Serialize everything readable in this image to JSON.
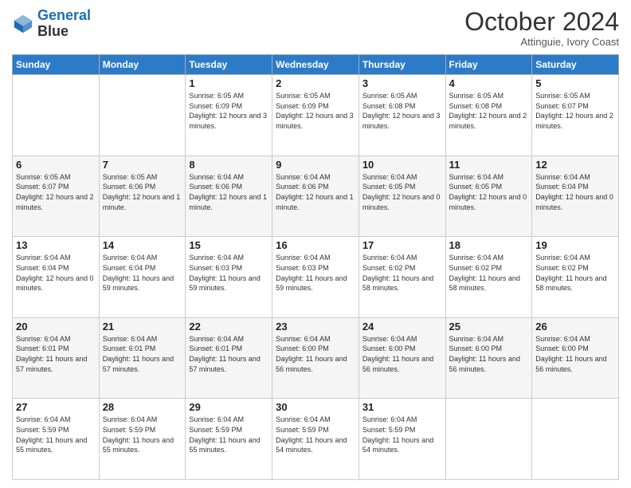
{
  "logo": {
    "line1": "General",
    "line2": "Blue"
  },
  "header": {
    "month": "October 2024",
    "location": "Attinguie, Ivory Coast"
  },
  "weekdays": [
    "Sunday",
    "Monday",
    "Tuesday",
    "Wednesday",
    "Thursday",
    "Friday",
    "Saturday"
  ],
  "weeks": [
    [
      {
        "day": "",
        "info": ""
      },
      {
        "day": "",
        "info": ""
      },
      {
        "day": "1",
        "info": "Sunrise: 6:05 AM\nSunset: 6:09 PM\nDaylight: 12 hours\nand 3 minutes."
      },
      {
        "day": "2",
        "info": "Sunrise: 6:05 AM\nSunset: 6:09 PM\nDaylight: 12 hours\nand 3 minutes."
      },
      {
        "day": "3",
        "info": "Sunrise: 6:05 AM\nSunset: 6:08 PM\nDaylight: 12 hours\nand 3 minutes."
      },
      {
        "day": "4",
        "info": "Sunrise: 6:05 AM\nSunset: 6:08 PM\nDaylight: 12 hours\nand 2 minutes."
      },
      {
        "day": "5",
        "info": "Sunrise: 6:05 AM\nSunset: 6:07 PM\nDaylight: 12 hours\nand 2 minutes."
      }
    ],
    [
      {
        "day": "6",
        "info": "Sunrise: 6:05 AM\nSunset: 6:07 PM\nDaylight: 12 hours\nand 2 minutes."
      },
      {
        "day": "7",
        "info": "Sunrise: 6:05 AM\nSunset: 6:06 PM\nDaylight: 12 hours\nand 1 minute."
      },
      {
        "day": "8",
        "info": "Sunrise: 6:04 AM\nSunset: 6:06 PM\nDaylight: 12 hours\nand 1 minute."
      },
      {
        "day": "9",
        "info": "Sunrise: 6:04 AM\nSunset: 6:06 PM\nDaylight: 12 hours\nand 1 minute."
      },
      {
        "day": "10",
        "info": "Sunrise: 6:04 AM\nSunset: 6:05 PM\nDaylight: 12 hours\nand 0 minutes."
      },
      {
        "day": "11",
        "info": "Sunrise: 6:04 AM\nSunset: 6:05 PM\nDaylight: 12 hours\nand 0 minutes."
      },
      {
        "day": "12",
        "info": "Sunrise: 6:04 AM\nSunset: 6:04 PM\nDaylight: 12 hours\nand 0 minutes."
      }
    ],
    [
      {
        "day": "13",
        "info": "Sunrise: 6:04 AM\nSunset: 6:04 PM\nDaylight: 12 hours\nand 0 minutes."
      },
      {
        "day": "14",
        "info": "Sunrise: 6:04 AM\nSunset: 6:04 PM\nDaylight: 11 hours\nand 59 minutes."
      },
      {
        "day": "15",
        "info": "Sunrise: 6:04 AM\nSunset: 6:03 PM\nDaylight: 11 hours\nand 59 minutes."
      },
      {
        "day": "16",
        "info": "Sunrise: 6:04 AM\nSunset: 6:03 PM\nDaylight: 11 hours\nand 59 minutes."
      },
      {
        "day": "17",
        "info": "Sunrise: 6:04 AM\nSunset: 6:02 PM\nDaylight: 11 hours\nand 58 minutes."
      },
      {
        "day": "18",
        "info": "Sunrise: 6:04 AM\nSunset: 6:02 PM\nDaylight: 11 hours\nand 58 minutes."
      },
      {
        "day": "19",
        "info": "Sunrise: 6:04 AM\nSunset: 6:02 PM\nDaylight: 11 hours\nand 58 minutes."
      }
    ],
    [
      {
        "day": "20",
        "info": "Sunrise: 6:04 AM\nSunset: 6:01 PM\nDaylight: 11 hours\nand 57 minutes."
      },
      {
        "day": "21",
        "info": "Sunrise: 6:04 AM\nSunset: 6:01 PM\nDaylight: 11 hours\nand 57 minutes."
      },
      {
        "day": "22",
        "info": "Sunrise: 6:04 AM\nSunset: 6:01 PM\nDaylight: 11 hours\nand 57 minutes."
      },
      {
        "day": "23",
        "info": "Sunrise: 6:04 AM\nSunset: 6:00 PM\nDaylight: 11 hours\nand 56 minutes."
      },
      {
        "day": "24",
        "info": "Sunrise: 6:04 AM\nSunset: 6:00 PM\nDaylight: 11 hours\nand 56 minutes."
      },
      {
        "day": "25",
        "info": "Sunrise: 6:04 AM\nSunset: 6:00 PM\nDaylight: 11 hours\nand 56 minutes."
      },
      {
        "day": "26",
        "info": "Sunrise: 6:04 AM\nSunset: 6:00 PM\nDaylight: 11 hours\nand 56 minutes."
      }
    ],
    [
      {
        "day": "27",
        "info": "Sunrise: 6:04 AM\nSunset: 5:59 PM\nDaylight: 11 hours\nand 55 minutes."
      },
      {
        "day": "28",
        "info": "Sunrise: 6:04 AM\nSunset: 5:59 PM\nDaylight: 11 hours\nand 55 minutes."
      },
      {
        "day": "29",
        "info": "Sunrise: 6:04 AM\nSunset: 5:59 PM\nDaylight: 11 hours\nand 55 minutes."
      },
      {
        "day": "30",
        "info": "Sunrise: 6:04 AM\nSunset: 5:59 PM\nDaylight: 11 hours\nand 54 minutes."
      },
      {
        "day": "31",
        "info": "Sunrise: 6:04 AM\nSunset: 5:59 PM\nDaylight: 11 hours\nand 54 minutes."
      },
      {
        "day": "",
        "info": ""
      },
      {
        "day": "",
        "info": ""
      }
    ]
  ]
}
